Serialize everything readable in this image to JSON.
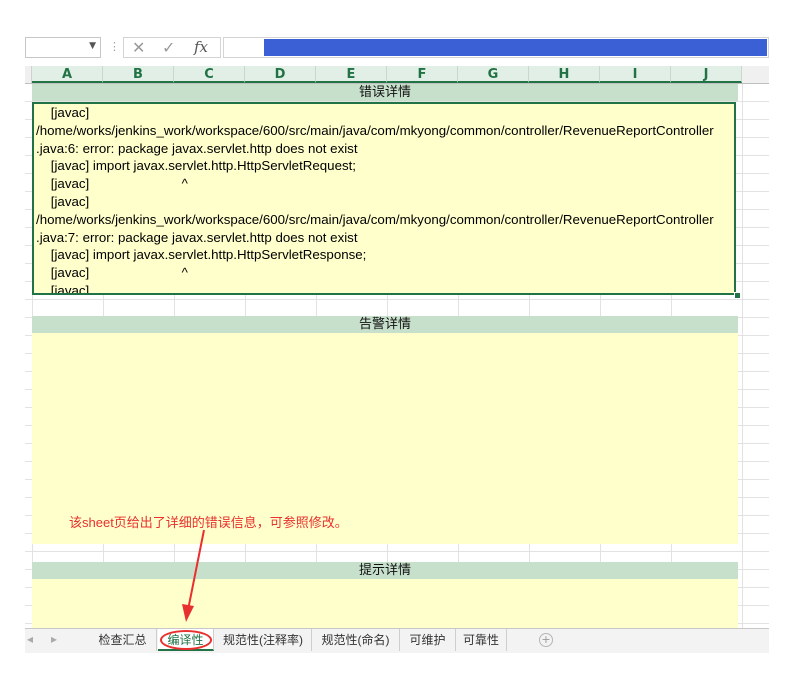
{
  "formula_bar": {
    "fx_label": "fx",
    "cancel_glyph": "✕",
    "enter_glyph": "✓",
    "name_box_value": "",
    "formula_value": ""
  },
  "columns": [
    "A",
    "B",
    "C",
    "D",
    "E",
    "F",
    "G",
    "H",
    "I",
    "J"
  ],
  "sections": {
    "error_title": "错误详情",
    "warning_title": "告警详情",
    "hint_title": "提示详情"
  },
  "error_lines": [
    "    [javac]",
    "/home/works/jenkins_work/workspace/600/src/main/java/com/mkyong/common/controller/RevenueReportController",
    ".java:6: error: package javax.servlet.http does not exist",
    "    [javac] import javax.servlet.http.HttpServletRequest;",
    "    [javac]                         ^",
    "    [javac]",
    "/home/works/jenkins_work/workspace/600/src/main/java/com/mkyong/common/controller/RevenueReportController",
    ".java:7: error: package javax.servlet.http does not exist",
    "    [javac] import javax.servlet.http.HttpServletResponse;",
    "    [javac]                         ^",
    "    [javac]"
  ],
  "annotation": "该sheet页给出了详细的错误信息，可参照修改。",
  "sheet_tabs": [
    "检查汇总",
    "编译性",
    "规范性(注释率)",
    "规范性(命名)",
    "可维护",
    "可靠性"
  ],
  "active_tab": "编译性",
  "colors": {
    "accent": "#217346",
    "header_band": "#c6e0cc",
    "cell_fill": "#ffffcc",
    "annotation": "#e8302e",
    "selection": "#3b5fd5"
  },
  "icons": [
    "chevron-down-icon",
    "cancel-icon",
    "enter-icon",
    "fx-icon",
    "scroll-left-icon",
    "scroll-right-icon",
    "add-sheet-icon",
    "arrow-annotation-icon"
  ]
}
